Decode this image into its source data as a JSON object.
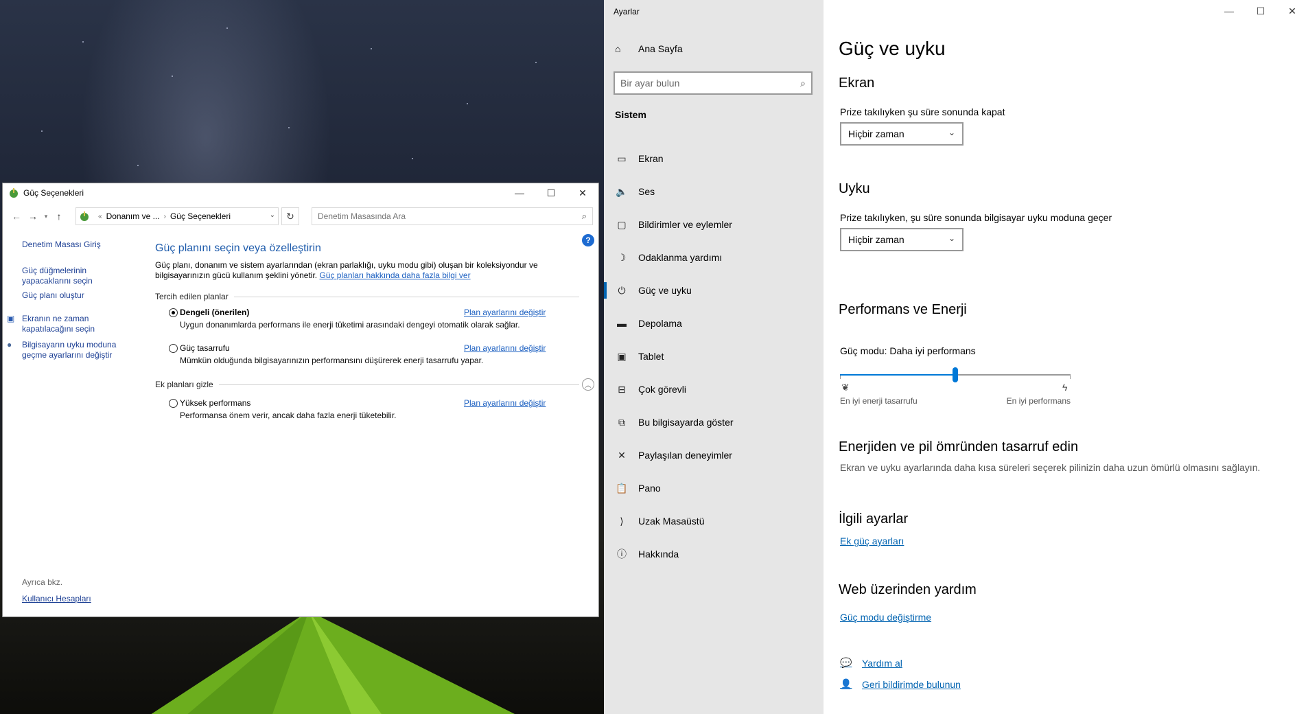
{
  "control_panel": {
    "title": "Güç Seçenekleri",
    "breadcrumb": [
      "Donanım ve ...",
      "Güç Seçenekleri"
    ],
    "breadcrumb_prefix": "«",
    "search_placeholder": "Denetim Masasında Ara",
    "left_links": [
      "Denetim Masası Giriş",
      "Güç düğmelerinin yapacaklarını seçin",
      "Güç planı oluştur",
      "Ekranın ne zaman kapatılacağını seçin",
      "Bilgisayarın uyku moduna geçme ayarlarını değiştir"
    ],
    "see_also_label": "Ayrıca bkz.",
    "see_also_link": "Kullanıcı Hesapları",
    "heading": "Güç planını seçin veya özelleştirin",
    "description": "Güç planı, donanım ve sistem ayarlarından (ekran parlaklığı, uyku modu gibi) oluşan bir koleksiyondur ve bilgisayarınızın gücü kullanım şeklini yönetir.",
    "description_link": "Güç planları hakkında daha fazla bilgi ver",
    "preferred_label": "Tercih edilen planlar",
    "extra_label": "Ek planları gizle",
    "change_link": "Plan ayarlarını değiştir",
    "plans": [
      {
        "name": "Dengeli (önerilen)",
        "desc": "Uygun donanımlarda performans ile enerji tüketimi arasındaki dengeyi otomatik olarak sağlar.",
        "selected": true
      },
      {
        "name": "Güç tasarrufu",
        "desc": "Mümkün olduğunda bilgisayarınızın performansını düşürerek enerji tasarrufu yapar.",
        "selected": false
      },
      {
        "name": "Yüksek performans",
        "desc": "Performansa önem verir, ancak daha fazla enerji tüketebilir.",
        "selected": false
      }
    ]
  },
  "settings": {
    "app_title": "Ayarlar",
    "home": "Ana Sayfa",
    "search_placeholder": "Bir ayar bulun",
    "section": "Sistem",
    "nav": [
      {
        "label": "Ekran",
        "icon": "monitor-icon",
        "glyph": "▭"
      },
      {
        "label": "Ses",
        "icon": "speaker-icon",
        "glyph": "🔈"
      },
      {
        "label": "Bildirimler ve eylemler",
        "icon": "notification-icon",
        "glyph": "▢"
      },
      {
        "label": "Odaklanma yardımı",
        "icon": "moon-icon",
        "glyph": "☽"
      },
      {
        "label": "Güç ve uyku",
        "icon": "power-icon",
        "glyph": "⏻"
      },
      {
        "label": "Depolama",
        "icon": "storage-icon",
        "glyph": "▬"
      },
      {
        "label": "Tablet",
        "icon": "tablet-icon",
        "glyph": "▣"
      },
      {
        "label": "Çok görevli",
        "icon": "multitask-icon",
        "glyph": "⊟"
      },
      {
        "label": "Bu bilgisayarda göster",
        "icon": "project-icon",
        "glyph": "⧉"
      },
      {
        "label": "Paylaşılan deneyimler",
        "icon": "shared-icon",
        "glyph": "✕"
      },
      {
        "label": "Pano",
        "icon": "clipboard-icon",
        "glyph": "📋"
      },
      {
        "label": "Uzak Masaüstü",
        "icon": "remote-desktop-icon",
        "glyph": "⟩"
      },
      {
        "label": "Hakkında",
        "icon": "info-icon",
        "glyph": "ⓘ"
      }
    ],
    "active_index": 4,
    "page_title": "Güç ve uyku",
    "screen_heading": "Ekran",
    "screen_label": "Prize takılıyken şu süre sonunda kapat",
    "screen_value": "Hiçbir zaman",
    "sleep_heading": "Uyku",
    "sleep_label": "Prize takılıyken, şu süre sonunda bilgisayar uyku moduna geçer",
    "sleep_value": "Hiçbir zaman",
    "perf_heading": "Performans ve Enerji",
    "power_mode_label": "Güç modu: Daha iyi performans",
    "power_mode_level": 0.5,
    "slider_min_label": "En iyi enerji tasarrufu",
    "slider_max_label": "En iyi performans",
    "save_heading": "Enerjiden ve pil ömründen tasarruf edin",
    "save_desc": "Ekran ve uyku ayarlarında daha kısa süreleri seçerek pilinizin daha uzun ömürlü olmasını sağlayın.",
    "related_heading": "İlgili ayarlar",
    "related_link": "Ek güç ayarları",
    "web_heading": "Web üzerinden yardım",
    "web_link": "Güç modu değiştirme",
    "get_help": "Yardım al",
    "feedback": "Geri bildirimde bulunun"
  }
}
